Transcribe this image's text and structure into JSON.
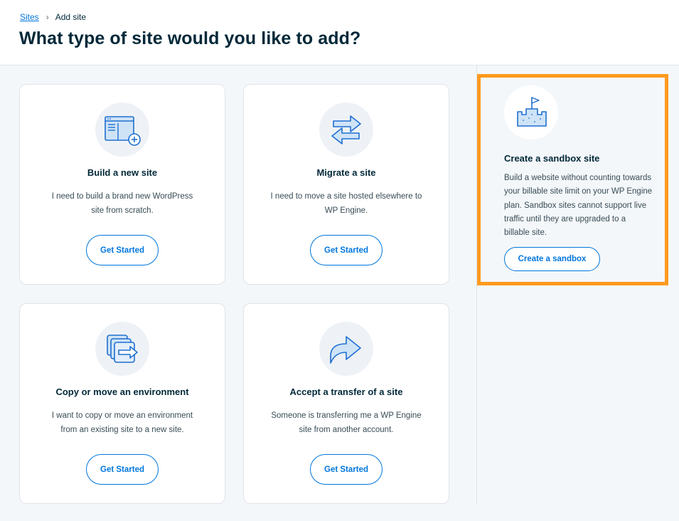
{
  "breadcrumb": {
    "link": "Sites",
    "separator": "›",
    "current": "Add site"
  },
  "page_title": "What type of site would you like to add?",
  "cards": [
    {
      "icon": "browser-window-add-icon",
      "title": "Build a new site",
      "description": "I need to build a brand new WordPress site from scratch.",
      "button": "Get Started"
    },
    {
      "icon": "migrate-arrows-icon",
      "title": "Migrate a site",
      "description": "I need to move a site hosted elsewhere to WP Engine.",
      "button": "Get Started"
    },
    {
      "icon": "copy-environment-icon",
      "title": "Copy or move an environment",
      "description": "I want to copy or move an environment from an existing site to a new site.",
      "button": "Get Started"
    },
    {
      "icon": "transfer-share-arrow-icon",
      "title": "Accept a transfer of a site",
      "description": "Someone is transferring me a WP Engine site from another account.",
      "button": "Get Started"
    }
  ],
  "sandbox": {
    "icon": "sandcastle-icon",
    "title": "Create a sandbox site",
    "description": "Build a website without counting towards your billable site limit on your WP Engine plan. Sandbox sites cannot support live traffic until they are upgraded to a billable site.",
    "button": "Create a sandbox"
  },
  "colors": {
    "accent": "#0076dc",
    "highlight_border": "#ff9a1f",
    "heading": "#002838",
    "background": "#f4f7fa"
  }
}
